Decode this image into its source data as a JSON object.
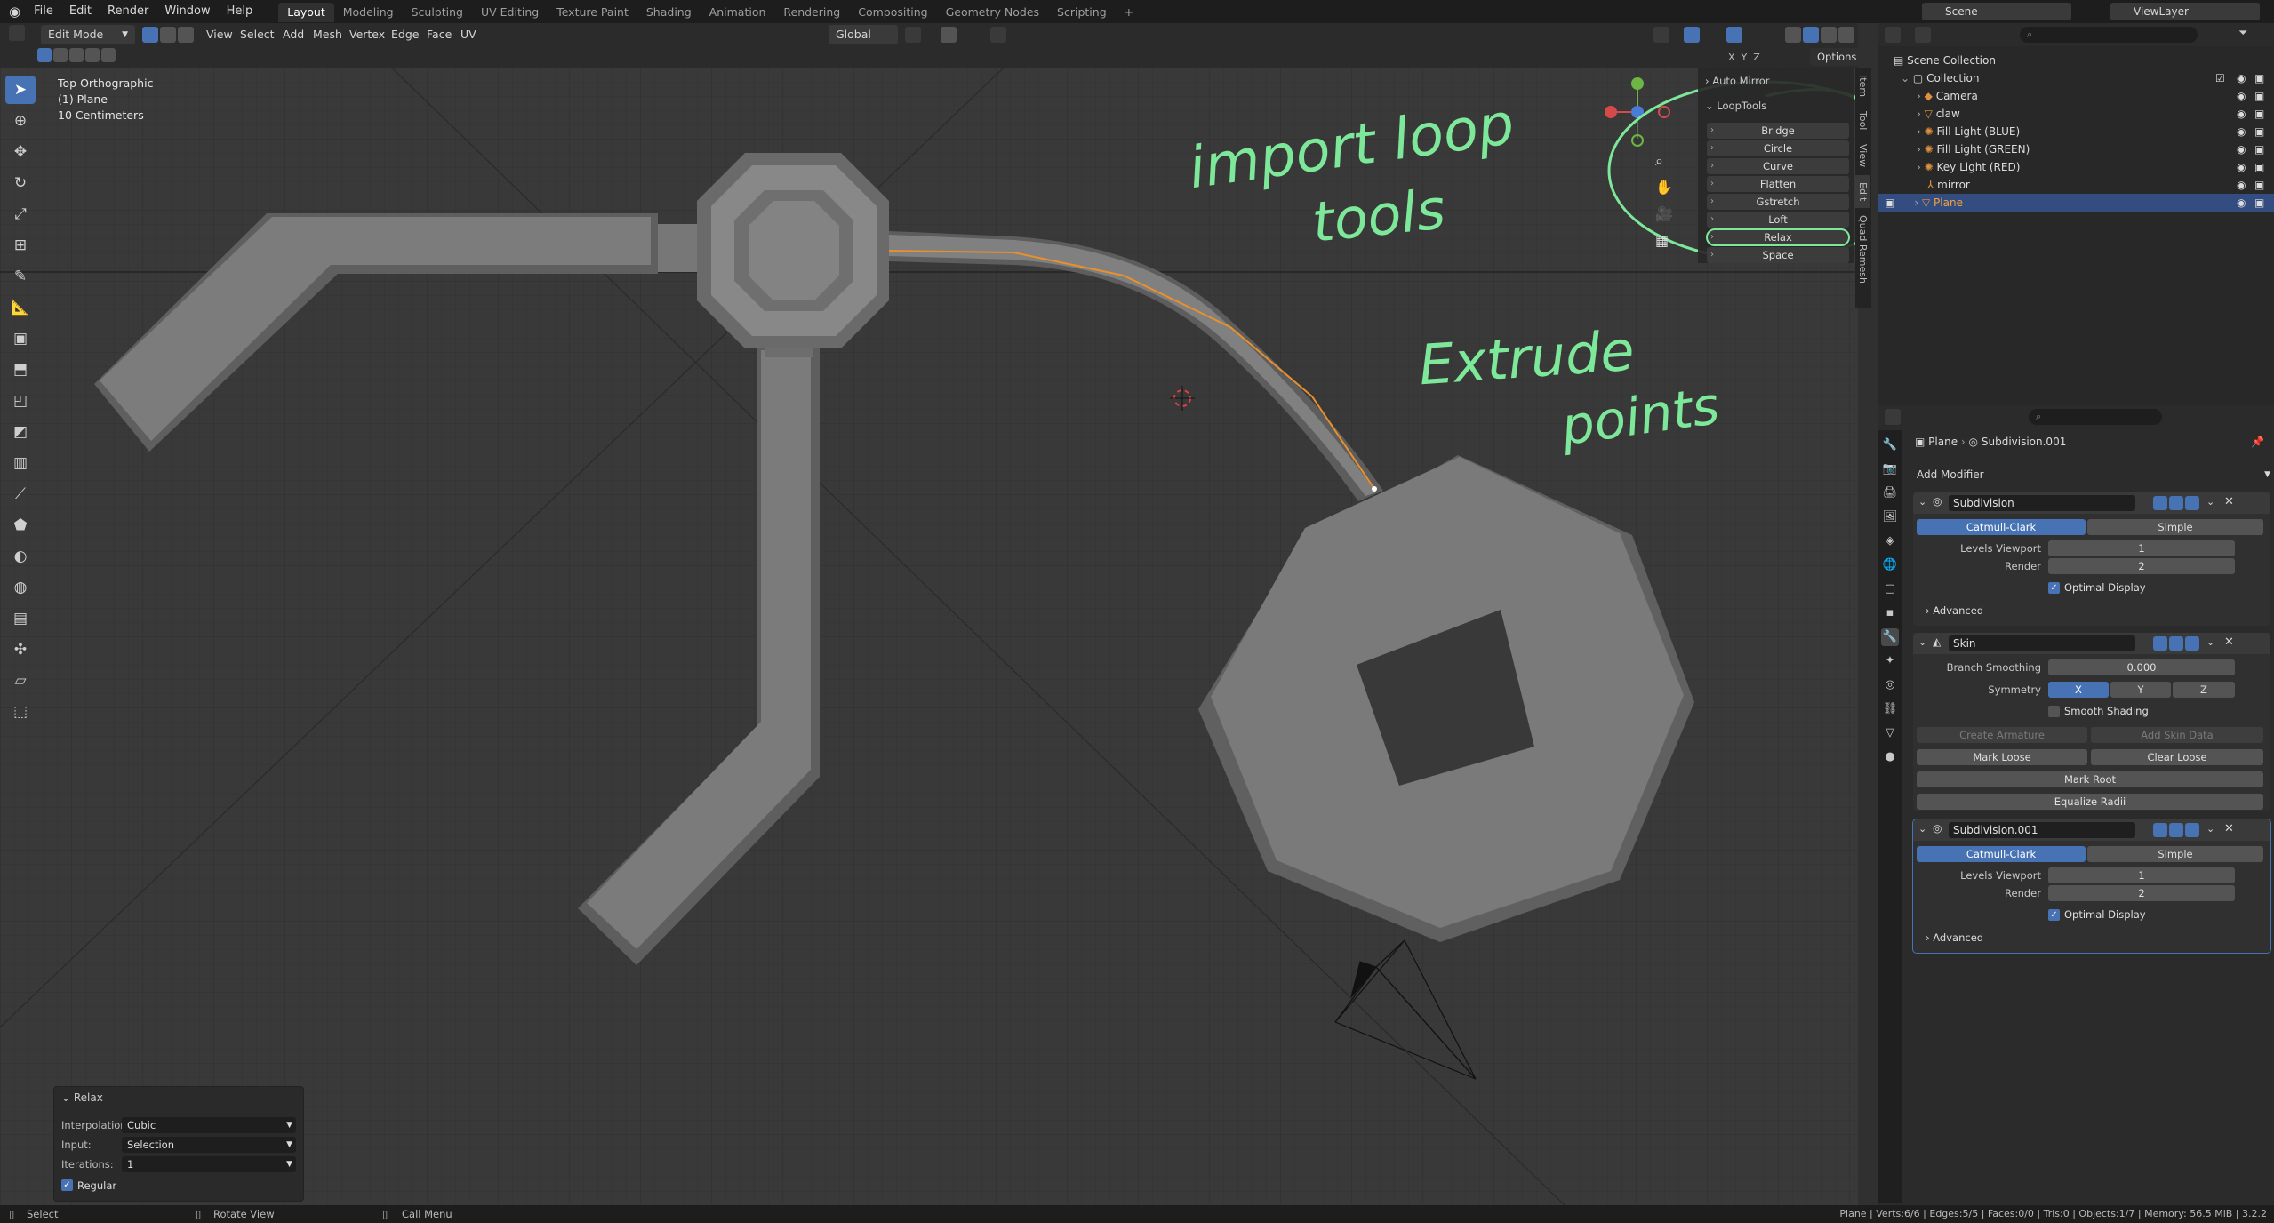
{
  "topbar": {
    "menus": [
      "File",
      "Edit",
      "Render",
      "Window",
      "Help"
    ],
    "workspaces": [
      "Layout",
      "Modeling",
      "Sculpting",
      "UV Editing",
      "Texture Paint",
      "Shading",
      "Animation",
      "Rendering",
      "Compositing",
      "Geometry Nodes",
      "Scripting"
    ],
    "active_workspace": "Layout",
    "add_tab": "+",
    "scene_label": "Scene",
    "viewlayer_label": "ViewLayer"
  },
  "viewport_header": {
    "mode": "Edit Mode",
    "menus": [
      "View",
      "Select",
      "Add",
      "Mesh",
      "Vertex",
      "Edge",
      "Face",
      "UV"
    ],
    "transform_orientation": "Global",
    "options_label": "Options",
    "axes": [
      "X",
      "Y",
      "Z"
    ]
  },
  "viewport_info": {
    "line1": "Top Orthographic",
    "line2": "(1) Plane",
    "line3": "10 Centimeters"
  },
  "npanel": {
    "tabs": [
      "Item",
      "Tool",
      "View",
      "Edit",
      "Quad Remesh"
    ],
    "auto_mirror": "Auto Mirror",
    "looptools_label": "LoopTools",
    "looptools_items": [
      "Bridge",
      "Circle",
      "Curve",
      "Flatten",
      "Gstretch",
      "Loft",
      "Relax",
      "Space"
    ]
  },
  "annotations": {
    "text1a": "import loop",
    "text1b": "tools",
    "text2a": "Extrude",
    "text2b": "points"
  },
  "operator_panel": {
    "title": "Relax",
    "interpolation_label": "Interpolation",
    "interpolation_value": "Cubic",
    "input_label": "Input:",
    "input_value": "Selection",
    "iterations_label": "Iterations:",
    "iterations_value": "1",
    "regular_label": "Regular"
  },
  "outliner": {
    "root": "Scene Collection",
    "collection": "Collection",
    "items": [
      "Camera",
      "claw",
      "Fill Light (BLUE)",
      "Fill Light (GREEN)",
      "Key Light (RED)",
      "mirror",
      "Plane"
    ],
    "selected": "Plane"
  },
  "properties": {
    "breadcrumb_object": "Plane",
    "breadcrumb_modifier": "Subdivision.001",
    "add_modifier": "Add Modifier",
    "mod1": {
      "name": "Subdivision",
      "catmull": "Catmull-Clark",
      "simple": "Simple",
      "levels_label": "Levels Viewport",
      "levels_value": "1",
      "render_label": "Render",
      "render_value": "2",
      "optimal_label": "Optimal Display",
      "advanced": "Advanced"
    },
    "mod2": {
      "name": "Skin",
      "branch_label": "Branch Smoothing",
      "branch_value": "0.000",
      "symmetry_label": "Symmetry",
      "sym_x": "X",
      "sym_y": "Y",
      "sym_z": "Z",
      "smooth_label": "Smooth Shading",
      "create_armature": "Create Armature",
      "add_skin_data": "Add Skin Data",
      "mark_loose": "Mark Loose",
      "clear_loose": "Clear Loose",
      "mark_root": "Mark Root",
      "equalize_radii": "Equalize Radii"
    },
    "mod3": {
      "name": "Subdivision.001",
      "catmull": "Catmull-Clark",
      "simple": "Simple",
      "levels_label": "Levels Viewport",
      "levels_value": "1",
      "render_label": "Render",
      "render_value": "2",
      "optimal_label": "Optimal Display",
      "advanced": "Advanced"
    }
  },
  "statusbar": {
    "select": "Select",
    "rotate": "Rotate View",
    "call_menu": "Call Menu",
    "stats": "Plane | Verts:6/6 | Edges:5/5 | Faces:0/0 | Tris:0 | Objects:1/7 | Memory: 56.5 MiB | 3.2.2"
  },
  "colors": {
    "accent_blue": "#4772b3",
    "annotation_green": "#7ee89a",
    "selected_edge": "#e8902c",
    "mesh_gray": "#7d7d7d"
  }
}
